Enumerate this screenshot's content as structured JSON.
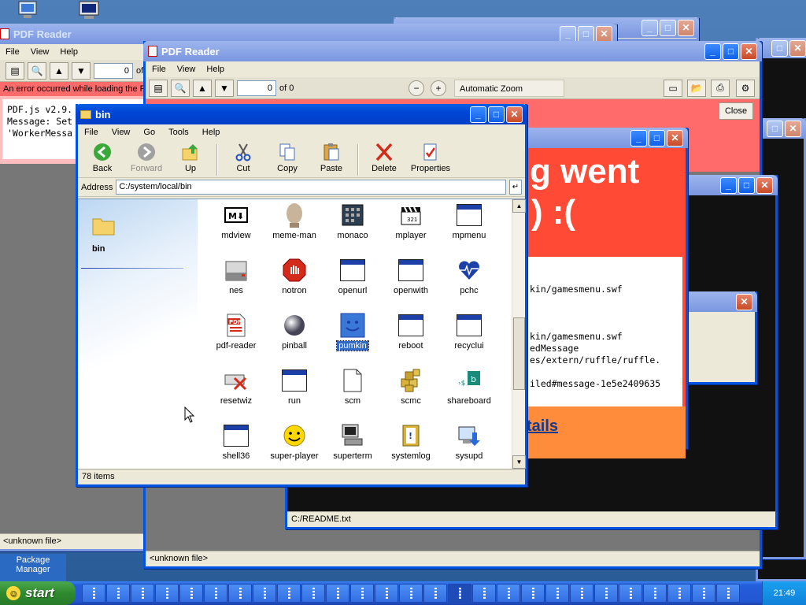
{
  "colors": {
    "accent": "#0054e3",
    "error_red": "#ff4a36",
    "error_orange": "#ff8c3a",
    "selection": "#316ac5"
  },
  "pdf_back": {
    "title": "PDF Reader",
    "menu": [
      "File",
      "View",
      "Help"
    ],
    "page_value": "0",
    "page_of": "of",
    "error_text": "An error occurred while loading the PDF.",
    "console": [
      "PDF.js v2.9.",
      "Message: Set",
      "'WorkerMessa"
    ],
    "status": "<unknown file>"
  },
  "pdf_front": {
    "title": "PDF Reader",
    "menu": [
      "File",
      "View",
      "Help"
    ],
    "page_value": "0",
    "page_of": "of 0",
    "zoom": "Automatic Zoom",
    "close_label": "Close",
    "status": "<unknown file>"
  },
  "error_win": {
    "heading": "g went",
    "heading2": ") :(",
    "lines": [
      "",
      "",
      "kin/gamesmenu.swf",
      "",
      "",
      "",
      "kin/gamesmenu.swf",
      "edMessage",
      "es/extern/ruffle/ruffle.",
      "",
      "iled#message-1e5e2409635"
    ],
    "details_link": "tails"
  },
  "readme_win": {
    "status": "C:/README.txt"
  },
  "explorer": {
    "title": "bin",
    "menu": [
      "File",
      "View",
      "Go",
      "Tools",
      "Help"
    ],
    "toolbar": {
      "back": "Back",
      "forward": "Forward",
      "up": "Up",
      "cut": "Cut",
      "copy": "Copy",
      "paste": "Paste",
      "delete": "Delete",
      "properties": "Properties"
    },
    "address_label": "Address",
    "address_value": "C:/system/local/bin",
    "side_folder": "bin",
    "items": [
      {
        "name": "mdview",
        "icon": "mdview-icon"
      },
      {
        "name": "meme-man",
        "icon": "meme-man-icon"
      },
      {
        "name": "monaco",
        "icon": "monaco-icon"
      },
      {
        "name": "mplayer",
        "icon": "clapboard-icon"
      },
      {
        "name": "mpmenu",
        "icon": "app-window-icon"
      },
      {
        "name": "nes",
        "icon": "nes-console-icon"
      },
      {
        "name": "notron",
        "icon": "stop-hand-icon"
      },
      {
        "name": "openurl",
        "icon": "app-window-icon"
      },
      {
        "name": "openwith",
        "icon": "app-window-icon"
      },
      {
        "name": "pchc",
        "icon": "heart-monitor-icon"
      },
      {
        "name": "pdf-reader",
        "icon": "pdf-icon"
      },
      {
        "name": "pinball",
        "icon": "pinball-icon"
      },
      {
        "name": "pumkin",
        "icon": "pumkin-icon",
        "selected": true
      },
      {
        "name": "reboot",
        "icon": "app-window-icon"
      },
      {
        "name": "recyclui",
        "icon": "app-window-icon"
      },
      {
        "name": "resetwiz",
        "icon": "resetwiz-icon"
      },
      {
        "name": "run",
        "icon": "app-window-icon"
      },
      {
        "name": "scm",
        "icon": "blank-file-icon"
      },
      {
        "name": "scmc",
        "icon": "cubes-icon"
      },
      {
        "name": "shareboard",
        "icon": "shareboard-icon"
      },
      {
        "name": "shell36",
        "icon": "app-window-icon"
      },
      {
        "name": "super-player",
        "icon": "smiley-icon"
      },
      {
        "name": "superterm",
        "icon": "terminal-computer-icon"
      },
      {
        "name": "systemlog",
        "icon": "log-book-icon"
      },
      {
        "name": "sysupd",
        "icon": "update-icon"
      }
    ],
    "status": "78 items"
  },
  "desktop": {
    "package_manager": "Package Manager"
  },
  "taskbar": {
    "start": "start",
    "clock": "21:49",
    "task_count": 27,
    "active_task": 15
  }
}
